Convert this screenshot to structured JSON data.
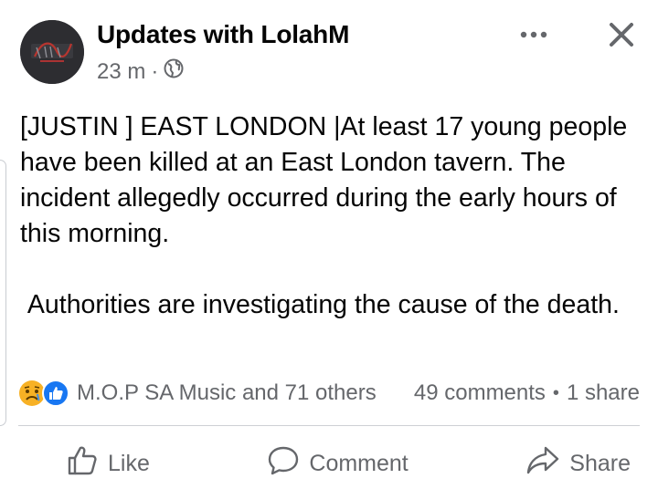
{
  "post": {
    "page_name": "Updates with LolahM",
    "timestamp": "23 m",
    "separator": "·",
    "paragraph1": "[JUSTIN ] EAST LONDON |At least 17 young people have been killed at an East London tavern. The incident allegedly occurred during the early hours of this morning.",
    "paragraph2": " Authorities are investigating the cause of the death."
  },
  "reactions": {
    "icons": [
      "sad-reaction-icon",
      "like-reaction-icon"
    ],
    "summary": "M.O.P SA Music and 71 others",
    "comments": "49 comments",
    "dot": "•",
    "shares": "1 share"
  },
  "actions": {
    "like": "Like",
    "comment": "Comment",
    "share": "Share"
  },
  "colors": {
    "text": "#050505",
    "muted": "#65676b",
    "like_blue": "#1877f2",
    "sad_yellow": "#f7b125",
    "divider": "#ced0d4"
  }
}
